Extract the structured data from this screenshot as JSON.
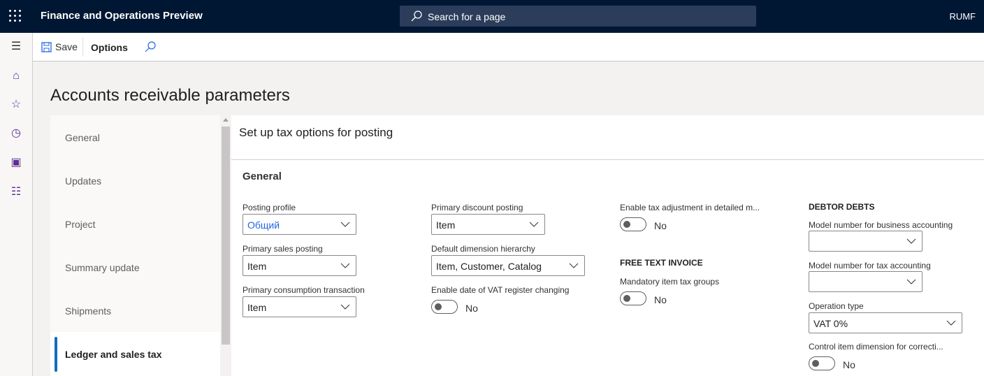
{
  "app": {
    "title": "Finance and Operations Preview",
    "search_placeholder": "Search for a page",
    "user": "RUMF"
  },
  "toolbar": {
    "save": "Save",
    "options": "Options"
  },
  "page": {
    "title": "Accounts receivable parameters"
  },
  "nav": {
    "items": [
      "General",
      "Updates",
      "Project",
      "Summary update",
      "Shipments",
      "Ledger and sales tax"
    ],
    "selected": "Ledger and sales tax"
  },
  "section": {
    "title": "Set up tax options for posting",
    "group": "General"
  },
  "fields": {
    "posting_profile": {
      "label": "Posting profile",
      "value": "Общий"
    },
    "primary_sales_posting": {
      "label": "Primary sales posting",
      "value": "Item"
    },
    "primary_consumption": {
      "label": "Primary consumption transaction",
      "value": "Item"
    },
    "primary_discount": {
      "label": "Primary discount posting",
      "value": "Item"
    },
    "default_dim": {
      "label": "Default dimension hierarchy",
      "value": "Item, Customer, Catalog"
    },
    "enable_vat_date": {
      "label": "Enable date of VAT register changing",
      "value": "No"
    },
    "enable_tax_adj": {
      "label": "Enable tax adjustment in detailed m...",
      "value": "No"
    },
    "free_text_header": "FREE TEXT INVOICE",
    "mandatory_tax": {
      "label": "Mandatory item tax groups",
      "value": "No"
    },
    "debtor_header": "DEBTOR DEBTS",
    "model_business": {
      "label": "Model number for business accounting",
      "value": ""
    },
    "model_tax": {
      "label": "Model number for tax accounting",
      "value": ""
    },
    "operation_type": {
      "label": "Operation type",
      "value": "VAT 0%"
    },
    "control_item": {
      "label": "Control item dimension for correcti...",
      "value": "No"
    }
  },
  "colors": {
    "topbar": "#001733",
    "accent": "#0f6cbd",
    "link": "#2266e3"
  }
}
